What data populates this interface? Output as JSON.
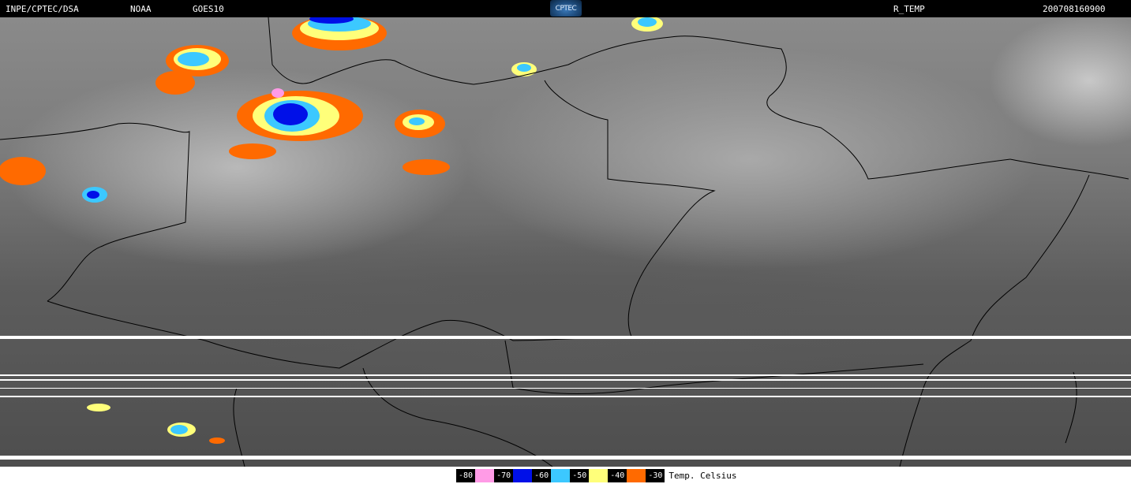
{
  "header": {
    "institution": "INPE/CPTEC/DSA",
    "agency": "NOAA",
    "satellite": "GOES10",
    "logo_text": "CPTEC",
    "product": "R_TEMP",
    "timestamp": "200708160900"
  },
  "legend": {
    "items": [
      {
        "label": "-80",
        "color": "#ff9be6"
      },
      {
        "label": "-70",
        "color": "#0010e8"
      },
      {
        "label": "-60",
        "color": "#3cc8ff"
      },
      {
        "label": "-50",
        "color": "#ffff7a"
      },
      {
        "label": "-40",
        "color": "#ff6a00"
      },
      {
        "label": "-30",
        "color": "#000000"
      }
    ],
    "title": "Temp. Celsius"
  }
}
